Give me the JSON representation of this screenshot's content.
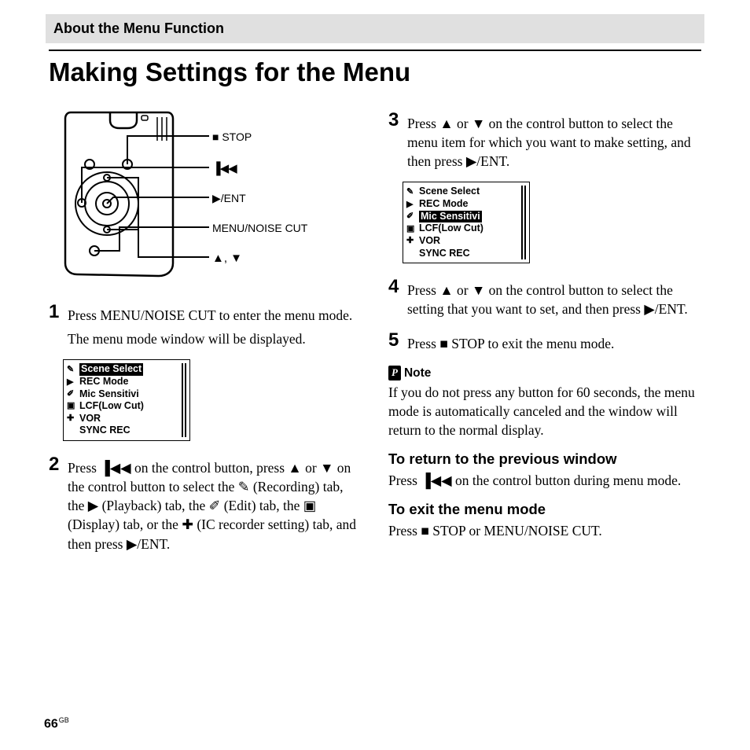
{
  "section_header": "About the Menu Function",
  "title": "Making Settings for the Menu",
  "device_labels": {
    "stop": "■ STOP",
    "prev": "▐◀◀",
    "ent": "▶/ENT",
    "menu": "MENU/NOISE CUT",
    "updown": "▲, ▼"
  },
  "screen1": {
    "items": [
      "Scene Select",
      "REC Mode",
      "Mic Sensitivi",
      "LCF(Low Cut)",
      "VOR",
      "SYNC REC"
    ],
    "highlight_index": 0,
    "icons": [
      "✎",
      "▶",
      "✐",
      "▣",
      "✚"
    ]
  },
  "screen2": {
    "items": [
      "Scene Select",
      "REC Mode",
      "Mic Sensitivi",
      "LCF(Low Cut)",
      "VOR",
      "SYNC REC"
    ],
    "highlight_index": 2,
    "icons": [
      "✎",
      "▶",
      "✐",
      "▣",
      "✚"
    ]
  },
  "steps": {
    "s1": {
      "num": "1",
      "p1": "Press MENU/NOISE CUT to enter the menu mode.",
      "p2": "The menu mode window will be displayed."
    },
    "s2": {
      "num": "2",
      "text_parts": {
        "a": "Press ",
        "b": " on the control button, press ▲ or ▼ on the control button to select the ",
        "rec": " (Recording) tab, the ",
        "play": " (Playback) tab, the ",
        "edit": " (Edit) tab, the ",
        "disp": " (Display) tab, or the ",
        "ic": " (IC recorder setting) tab, and then press ▶/ENT."
      },
      "glyphs": {
        "prev": "▐◀◀",
        "rec_icon": "✎",
        "play_icon": "▶",
        "edit_icon": "✐",
        "disp_icon": "▣",
        "ic_icon": "✚"
      }
    },
    "s3": {
      "num": "3",
      "text": "Press ▲ or ▼ on the control button to select the menu item for which you want to make setting, and then press ▶/ENT."
    },
    "s4": {
      "num": "4",
      "text": "Press ▲ or ▼ on the control button to select the setting that you want to set, and then press ▶/ENT."
    },
    "s5": {
      "num": "5",
      "text": "Press ■ STOP to exit the menu mode."
    }
  },
  "note": {
    "label": "Note",
    "icon": "P",
    "text": "If you do not press any button for 60 seconds, the menu mode is automatically canceled and the window will return to the normal display."
  },
  "return_prev": {
    "heading": "To return to the previous window",
    "text_a": "Press ",
    "glyph": "▐◀◀",
    "text_b": " on the control button during menu mode."
  },
  "exit_menu": {
    "heading": "To exit the menu mode",
    "text": "Press ■ STOP or MENU/NOISE CUT."
  },
  "page_number": "66",
  "page_suffix": "GB"
}
